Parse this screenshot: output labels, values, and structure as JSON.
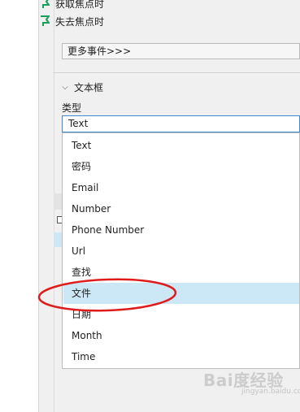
{
  "events": {
    "items": [
      {
        "label": "获取焦点时",
        "icon": "event-flag-icon"
      },
      {
        "label": "失去焦点时",
        "icon": "event-flag-icon"
      }
    ],
    "more_label": "更多事件>>>"
  },
  "textbox_section": {
    "title": "文本框",
    "chevron": "⌵",
    "type_label": "类型",
    "selected_value": "Text",
    "options": [
      "Text",
      "密码",
      "Email",
      "Number",
      "Phone Number",
      "Url",
      "查找",
      "文件",
      "日期",
      "Month",
      "Time"
    ],
    "highlighted_option": "文件"
  },
  "colors": {
    "panel_bg": "#f0f0f0",
    "select_border": "#3c8ad0",
    "highlight": "#cce8f7",
    "annotation": "#e01b1b",
    "event_icon": "#18a058"
  },
  "watermark": {
    "text": "Bai度经验",
    "sub": "jingyan.baidu.com"
  }
}
